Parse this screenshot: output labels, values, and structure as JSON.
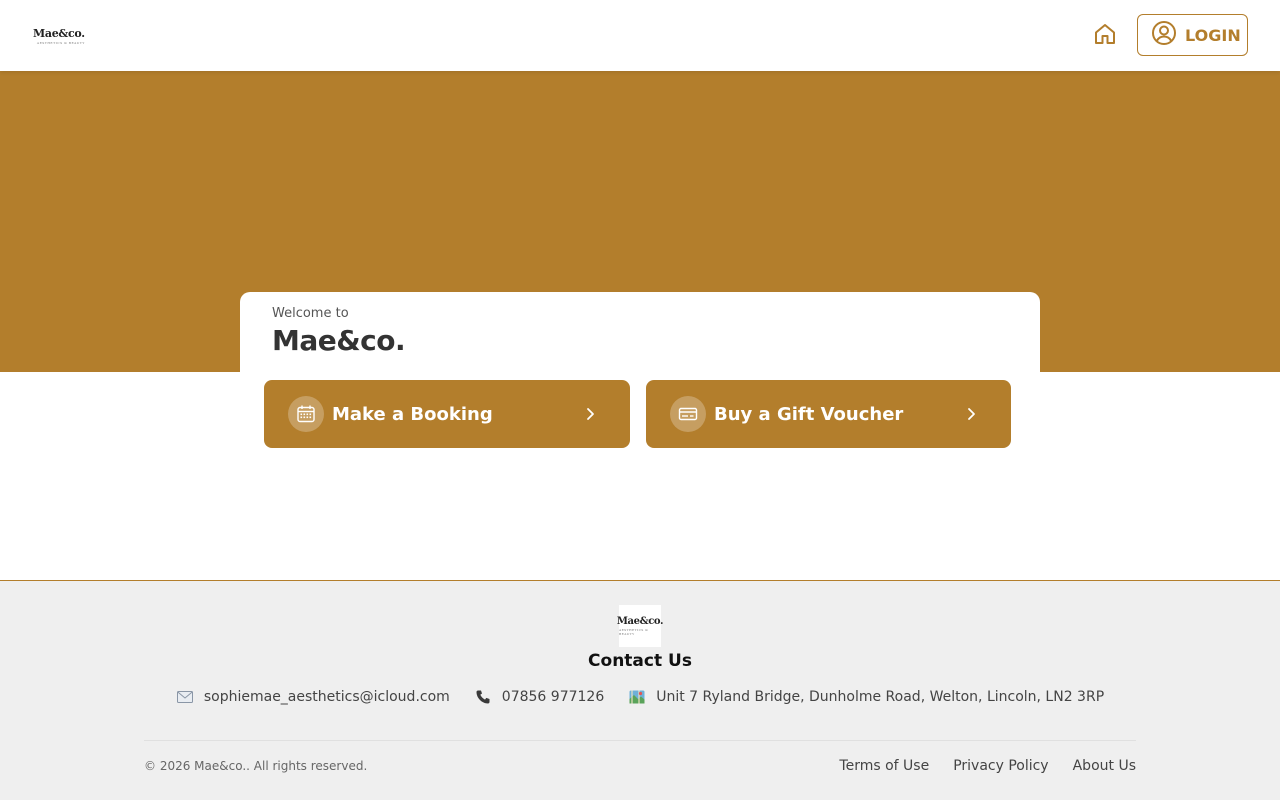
{
  "header": {
    "logo_text": "Mae&co.",
    "logo_tag": "AESTHETICS & BEAUTY",
    "login_label": "LOGIN"
  },
  "welcome": {
    "subtitle": "Welcome to",
    "title": "Mae&co."
  },
  "actions": {
    "booking_label": "Make a Booking",
    "voucher_label": "Buy a Gift Voucher"
  },
  "footer": {
    "logo_text": "Mae&co.",
    "logo_tag": "AESTHETICS & BEAUTY",
    "contact_title": "Contact Us",
    "email": "sophiemae_aesthetics@icloud.com",
    "phone": "07856 977126",
    "address": "Unit 7 Ryland Bridge, Dunholme Road, Welton, Lincoln, LN2 3RP",
    "copyright": "© 2026 Mae&co.. All rights reserved.",
    "links": [
      "Terms of Use",
      "Privacy Policy",
      "About Us"
    ]
  },
  "icons": {
    "home": "home-icon",
    "user": "user-circle-icon",
    "calendar": "calendar-icon",
    "voucher": "credit-card-icon",
    "chevron": "chevron-right-icon",
    "email": "envelope-icon",
    "phone": "phone-icon",
    "address": "map-icon"
  },
  "colors": {
    "brand": "#b37e2c",
    "footer_bg": "#efefef"
  }
}
